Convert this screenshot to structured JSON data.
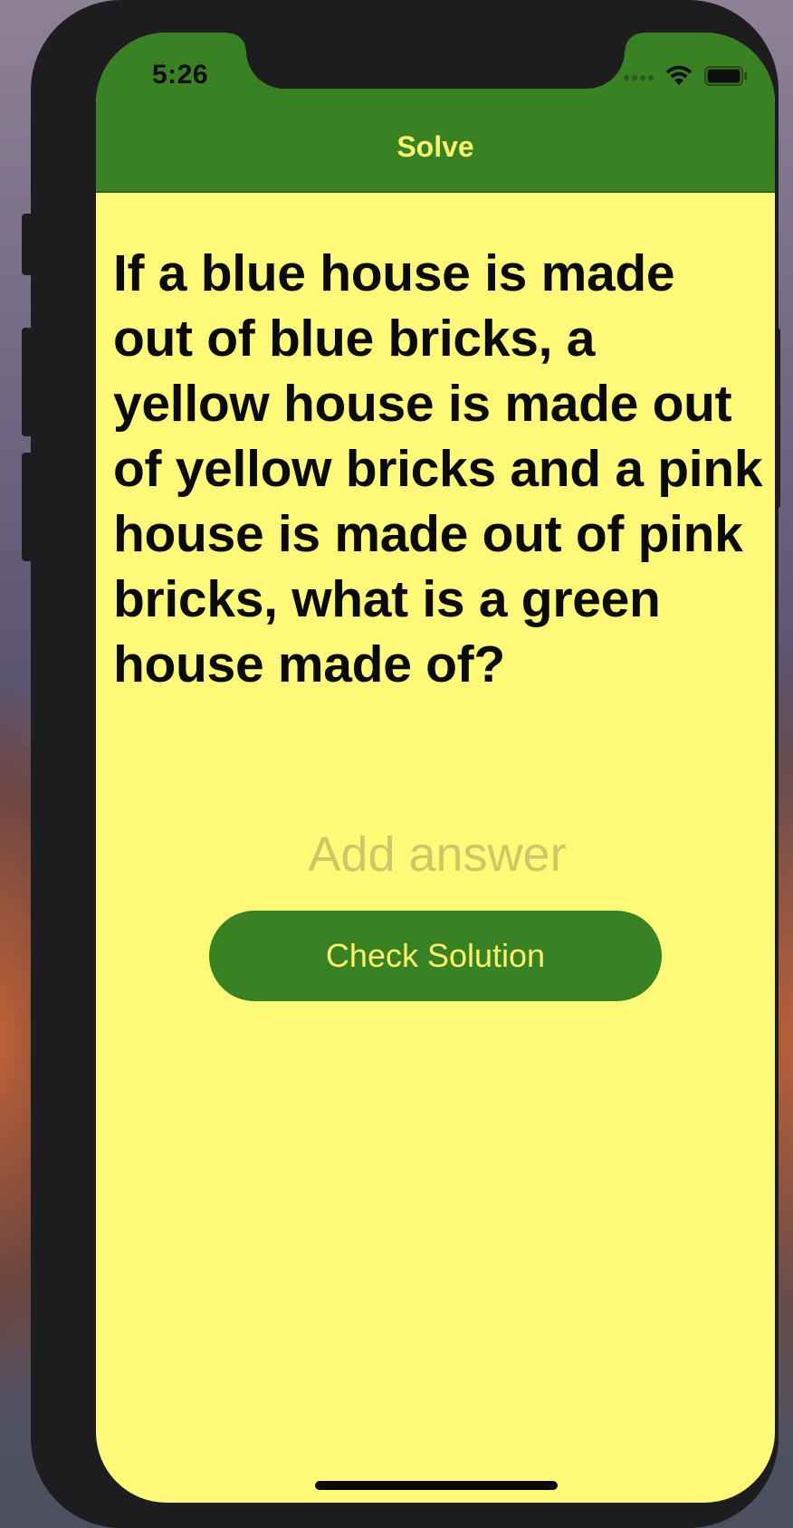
{
  "status_bar": {
    "time": "5:26",
    "icons": [
      "signal-dots-icon",
      "wifi-icon",
      "battery-icon"
    ]
  },
  "navbar": {
    "title": "Solve"
  },
  "question": {
    "text": "If a blue house is made out of blue bricks, a yellow house is made out of yellow bricks and a pink house is made out of pink bricks, what is a green house made of?"
  },
  "answer_field": {
    "value": "",
    "placeholder": "Add answer"
  },
  "check_button": {
    "label": "Check Solution"
  },
  "colors": {
    "navbar_background": "#388224",
    "screen_background": "#fffb78",
    "accent_text": "#fcf36c",
    "placeholder_text": "#cfc765",
    "button_background": "#388224"
  }
}
